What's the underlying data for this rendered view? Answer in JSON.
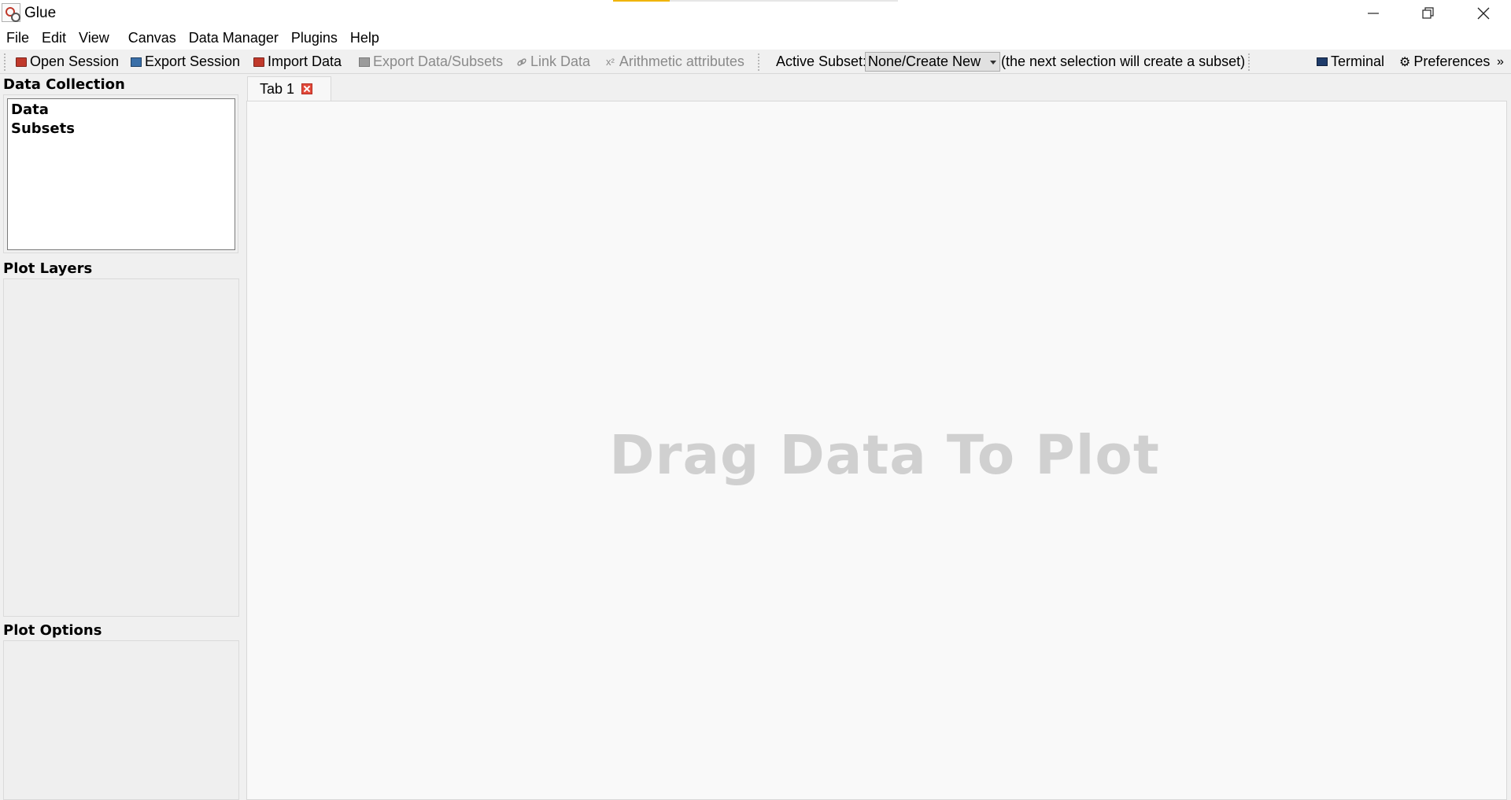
{
  "window": {
    "title": "Glue",
    "controls": {
      "minimize": "minimize-icon",
      "maximize": "restore-icon",
      "close": "close-icon"
    }
  },
  "menu": {
    "items": [
      "File",
      "Edit",
      "View",
      "Canvas",
      "Data Manager",
      "Plugins",
      "Help"
    ]
  },
  "toolbar": {
    "open_session": "Open Session",
    "export_session": "Export Session",
    "import_data": "Import Data",
    "export_data_subsets": "Export Data/Subsets",
    "link_data": "Link Data",
    "arithmetic_attributes": "Arithmetic attributes",
    "arithmetic_icon": "x²",
    "active_subset_label": "Active Subset:",
    "active_subset_value": "None/Create New",
    "active_subset_hint": "(the next selection will create a subset)",
    "terminal": "Terminal",
    "preferences": "Preferences",
    "overflow": "»"
  },
  "sidebar": {
    "data_collection_title": "Data Collection",
    "data_collection_items": [
      "Data",
      "Subsets"
    ],
    "plot_layers_title": "Plot Layers",
    "plot_options_title": "Plot Options"
  },
  "tabs": [
    {
      "label": "Tab 1"
    }
  ],
  "canvas": {
    "placeholder": "Drag Data To Plot"
  },
  "colors": {
    "placeholder_text": "#d0d0d0",
    "tab_close": "#e24a3b",
    "title_accent": "#f0b400"
  }
}
